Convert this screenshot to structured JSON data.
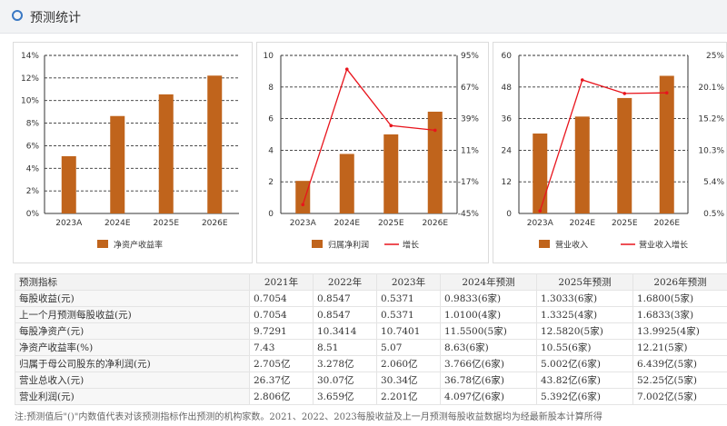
{
  "header": {
    "title": "预测统计",
    "icon": "circle-icon"
  },
  "colors": {
    "bar": "#c0641c",
    "line": "#e8141c",
    "grid": "#333333",
    "accent": "#3a78c4"
  },
  "chart_data": [
    {
      "type": "bar",
      "categories": [
        "2023A",
        "2024E",
        "2025E",
        "2026E"
      ],
      "series": [
        {
          "name": "净资产收益率",
          "values": [
            5.07,
            8.63,
            10.55,
            12.21
          ]
        }
      ],
      "ylim": [
        0,
        14
      ],
      "yticks": [
        "0%",
        "2%",
        "4%",
        "6%",
        "8%",
        "10%",
        "12%",
        "14%"
      ],
      "legend": [
        {
          "label": "净资产收益率",
          "kind": "bar"
        }
      ],
      "grid": true,
      "legend_position": "bottom"
    },
    {
      "type": "bar",
      "categories": [
        "2023A",
        "2024E",
        "2025E",
        "2026E"
      ],
      "series": [
        {
          "name": "归属净利润",
          "type": "bar",
          "values": [
            2.06,
            3.766,
            5.002,
            6.439
          ]
        },
        {
          "name": "增长",
          "type": "line",
          "axis": "right",
          "values": [
            -37.2,
            82.8,
            32.8,
            28.7
          ]
        }
      ],
      "ylim": [
        0,
        10
      ],
      "yticks": [
        "0",
        "2",
        "4",
        "6",
        "8",
        "10"
      ],
      "y2lim": [
        -45,
        95
      ],
      "y2ticks": [
        "-45%",
        "-17%",
        "11%",
        "39%",
        "67%",
        "95%"
      ],
      "legend": [
        {
          "label": "归属净利润",
          "kind": "bar"
        },
        {
          "label": "增长",
          "kind": "line"
        }
      ],
      "grid": true,
      "legend_position": "bottom"
    },
    {
      "type": "bar",
      "categories": [
        "2023A",
        "2024E",
        "2025E",
        "2026E"
      ],
      "series": [
        {
          "name": "营业收入",
          "type": "bar",
          "values": [
            30.34,
            36.78,
            43.82,
            52.25
          ]
        },
        {
          "name": "营业收入增长",
          "type": "line",
          "axis": "right",
          "values": [
            0.9,
            21.2,
            19.1,
            19.2
          ]
        }
      ],
      "ylim": [
        0,
        60
      ],
      "yticks": [
        "0",
        "12",
        "24",
        "36",
        "48",
        "60"
      ],
      "y2lim": [
        0.5,
        25
      ],
      "y2ticks": [
        "0.5%",
        "5.4%",
        "10.3%",
        "15.2%",
        "20.1%",
        "25%"
      ],
      "legend": [
        {
          "label": "营业收入",
          "kind": "bar"
        },
        {
          "label": "营业收入增长",
          "kind": "line"
        }
      ],
      "grid": true,
      "legend_position": "bottom"
    }
  ],
  "table": {
    "headers": [
      "预测指标",
      "2021年",
      "2022年",
      "2023年",
      "2024年预测",
      "2025年预测",
      "2026年预测"
    ],
    "rows": [
      [
        "每股收益(元)",
        "0.7054",
        "0.8547",
        "0.5371",
        "0.9833(6家)",
        "1.3033(6家)",
        "1.6800(5家)"
      ],
      [
        "上一个月预测每股收益(元)",
        "0.7054",
        "0.8547",
        "0.5371",
        "1.0100(4家)",
        "1.3325(4家)",
        "1.6833(3家)"
      ],
      [
        "每股净资产(元)",
        "9.7291",
        "10.3414",
        "10.7401",
        "11.5500(5家)",
        "12.5820(5家)",
        "13.9925(4家)"
      ],
      [
        "净资产收益率(%)",
        "7.43",
        "8.51",
        "5.07",
        "8.63(6家)",
        "10.55(6家)",
        "12.21(5家)"
      ],
      [
        "归属于母公司股东的净利润(元)",
        "2.705亿",
        "3.278亿",
        "2.060亿",
        "3.766亿(6家)",
        "5.002亿(6家)",
        "6.439亿(5家)"
      ],
      [
        "营业总收入(元)",
        "26.37亿",
        "30.07亿",
        "30.34亿",
        "36.78亿(6家)",
        "43.82亿(6家)",
        "52.25亿(5家)"
      ],
      [
        "营业利润(元)",
        "2.806亿",
        "3.659亿",
        "2.201亿",
        "4.097亿(6家)",
        "5.392亿(6家)",
        "7.002亿(5家)"
      ]
    ]
  },
  "note": "注:预测值后\"()\"内数值代表对该预测指标作出预测的机构家数。2021、2022、2023每股收益及上一月预测每股收益数据均为经最新股本计算所得"
}
